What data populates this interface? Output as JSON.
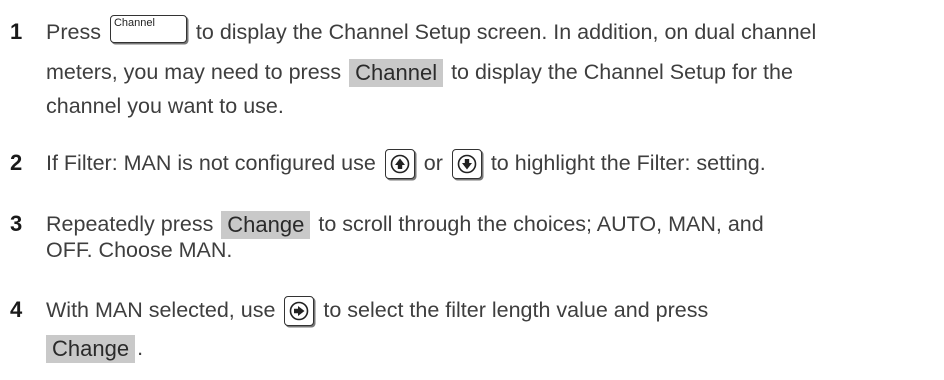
{
  "steps": [
    {
      "number": "1",
      "lines": [
        {
          "before": "Press ",
          "key_label": "Channel",
          "after": " to display the Channel Setup screen. In addition, on dual channel"
        },
        {
          "before": "meters, you may need to press ",
          "softkey": "Channel",
          "after": " to display the Channel Setup for the"
        },
        {
          "text": "channel you want to use."
        }
      ]
    },
    {
      "number": "2",
      "lines": [
        {
          "before": "If Filter: MAN is not configured use ",
          "key1": "up-arrow-key",
          "middle": " or ",
          "key2": "down-arrow-key",
          "after": " to highlight the Filter: setting."
        }
      ]
    },
    {
      "number": "3",
      "lines": [
        {
          "before": "Repeatedly press ",
          "softkey": "Change",
          "after": " to scroll through the choices; AUTO, MAN, and"
        },
        {
          "text": "OFF. Choose MAN."
        }
      ]
    },
    {
      "number": "4",
      "lines": [
        {
          "before": "With MAN selected, use ",
          "key": "right-arrow-key",
          "after": " to select the filter length value and press"
        },
        {
          "softkey": "Change",
          "after": "."
        }
      ]
    }
  ]
}
